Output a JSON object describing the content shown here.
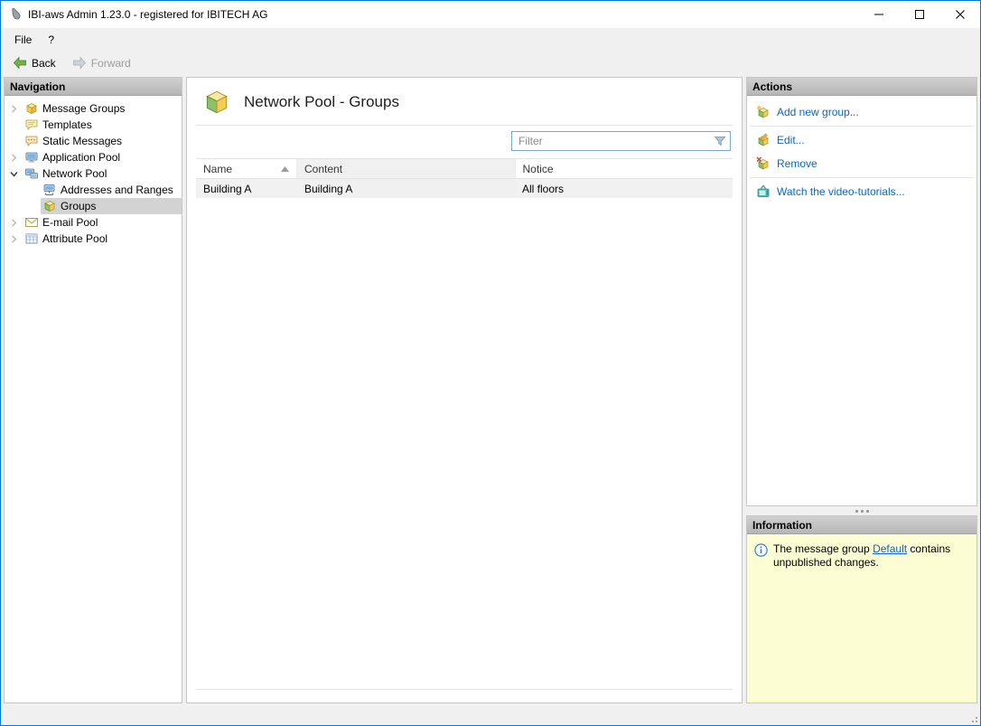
{
  "window": {
    "title": "IBI-aws Admin 1.23.0 - registered for IBITECH AG"
  },
  "menubar": {
    "file": "File",
    "help": "?"
  },
  "toolbar": {
    "back": "Back",
    "forward": "Forward"
  },
  "navigation": {
    "header": "Navigation",
    "items": [
      {
        "label": "Message Groups"
      },
      {
        "label": "Templates"
      },
      {
        "label": "Static Messages"
      },
      {
        "label": "Application Pool"
      },
      {
        "label": "Network Pool"
      },
      {
        "label": "Addresses and Ranges"
      },
      {
        "label": "Groups"
      },
      {
        "label": "E-mail Pool"
      },
      {
        "label": "Attribute Pool"
      }
    ]
  },
  "main": {
    "title": "Network Pool - Groups",
    "filter_placeholder": "Filter",
    "table": {
      "columns": [
        "Name",
        "Content",
        "Notice"
      ],
      "rows": [
        {
          "name": "Building A",
          "content": "Building A",
          "notice": "All floors"
        }
      ]
    }
  },
  "actions": {
    "header": "Actions",
    "items": [
      {
        "label": "Add new group..."
      },
      {
        "label": "Edit..."
      },
      {
        "label": "Remove"
      },
      {
        "label": "Watch the video-tutorials..."
      }
    ]
  },
  "information": {
    "header": "Information",
    "text_before": "The message group ",
    "link_label": "Default",
    "text_after": " contains unpublished changes."
  },
  "theme": {
    "accent_border": "#0079d8",
    "link_color": "#0a66c2",
    "info_background": "#fdfdd3",
    "selection_background": "#d3d3d3"
  }
}
